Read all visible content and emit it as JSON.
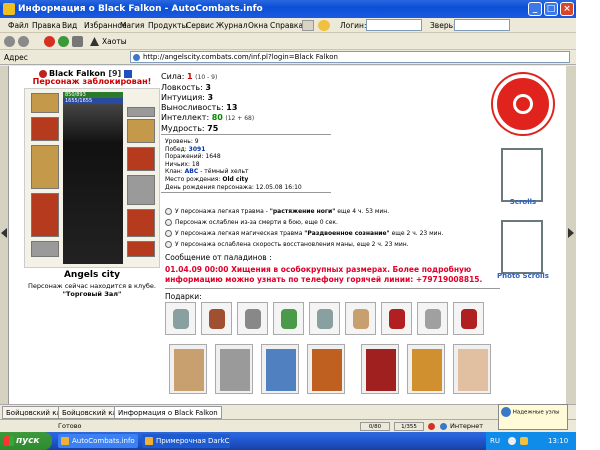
{
  "window": {
    "title": "Информация о Black Falkon - AutoCombats.info",
    "buttons": {
      "minimize": "_",
      "maximize": "□",
      "close": "×"
    }
  },
  "menu": [
    "Файл",
    "Правка",
    "Вид",
    "Избранное",
    "Магия",
    "Продукты",
    "Сервис",
    "Журнал",
    "Окна",
    "Справка"
  ],
  "toolbar": {
    "login_label": "Логин:",
    "beast_label": "Зверь:",
    "chaos_label": "Хаоты"
  },
  "address": {
    "label": "Адрес",
    "url": "http://angelscity.combats.com/inf.pl?login=Black Falkon"
  },
  "character": {
    "name": "Black Falkon",
    "level": "[9]",
    "blocked": "Персонаж заблокирован!",
    "hp": "850/893",
    "mp": "1655/1655",
    "guild": "Angels city",
    "location_prefix": "Персонаж сейчас находится в клубе.",
    "location_room": "\"Торговый Зал\""
  },
  "stats": [
    {
      "label": "Сила:",
      "value": "1",
      "extra": "(10 - 9)",
      "color": "#cc0000"
    },
    {
      "label": "Ловкость:",
      "value": "3",
      "extra": ""
    },
    {
      "label": "Интуиция:",
      "value": "3",
      "extra": ""
    },
    {
      "label": "Выносливость:",
      "value": "13",
      "extra": ""
    },
    {
      "label": "Интеллект:",
      "value": "80",
      "extra": "(12 + 68)",
      "color": "#008800"
    },
    {
      "label": "Мудрость:",
      "value": "75",
      "extra": ""
    }
  ],
  "info": {
    "level": "Уровень: 9",
    "wins_label": "Побед:",
    "wins": "3091",
    "losses": "Поражений: 1648",
    "draws": "Ничьих: 18",
    "clan_label": "Клан:",
    "clan": "ABC",
    "clan_suffix": "- тёмный хельт",
    "birthplace_label": "Место рождения:",
    "birthplace": "Old city",
    "birthday": "День рождения персонажа: 12.05.08 16:10"
  },
  "effects": [
    {
      "pre": "У персонажа легкая травма - ",
      "bold": "\"растяжение ноги\"",
      "post": " еще 4 ч. 53 мин."
    },
    {
      "pre": "Персонаж ослаблен из-за смерти в бою, еще 0 сек.",
      "bold": "",
      "post": ""
    },
    {
      "pre": "У персонажа легкая магическая травма ",
      "bold": "\"Раздвоенное сознание\"",
      "post": " еще 2 ч. 23 мин."
    },
    {
      "pre": "У персонажа ослаблена скорость восстановления маны, еще 2 ч. 23 мин.",
      "bold": "",
      "post": ""
    }
  ],
  "message": {
    "header": "Сообщение от паладинов :",
    "text": "01.04.09 00:00 Хищения в особокрупных размерах. Более подробную информацию можно узнать по телефону горячей линии: +79719008815."
  },
  "gifts": {
    "header": "Подарки:",
    "colors": [
      "#8aa0a0",
      "#a05030",
      "#888",
      "#4a9a4a",
      "#8aa0a0",
      "#c8a070",
      "#b02020",
      "#a0a0a0",
      "#b02020"
    ],
    "cards": [
      "#c8a070",
      "#9a9a9a",
      "#5080c0",
      "#c06020",
      "#a02020",
      "#d09030",
      "#e0c0a0"
    ]
  },
  "banners": {
    "scrolls": "Scrolls",
    "photo_scrolls": "Photo Scrolls"
  },
  "tabs": [
    "Бойцовский клуб",
    "Бойцовский клуб",
    "Информация о Black Falkon"
  ],
  "status": {
    "text": "Готово",
    "counters": [
      "0/80",
      "1/355"
    ],
    "zone": "Интернет"
  },
  "notify": {
    "line1": "Надежные узлы"
  },
  "taskbar": {
    "start": "пуск",
    "tasks": [
      "AutoCombats.info",
      "Примерочная DarkCl..."
    ],
    "lang": "RU",
    "clock": "13:10"
  }
}
